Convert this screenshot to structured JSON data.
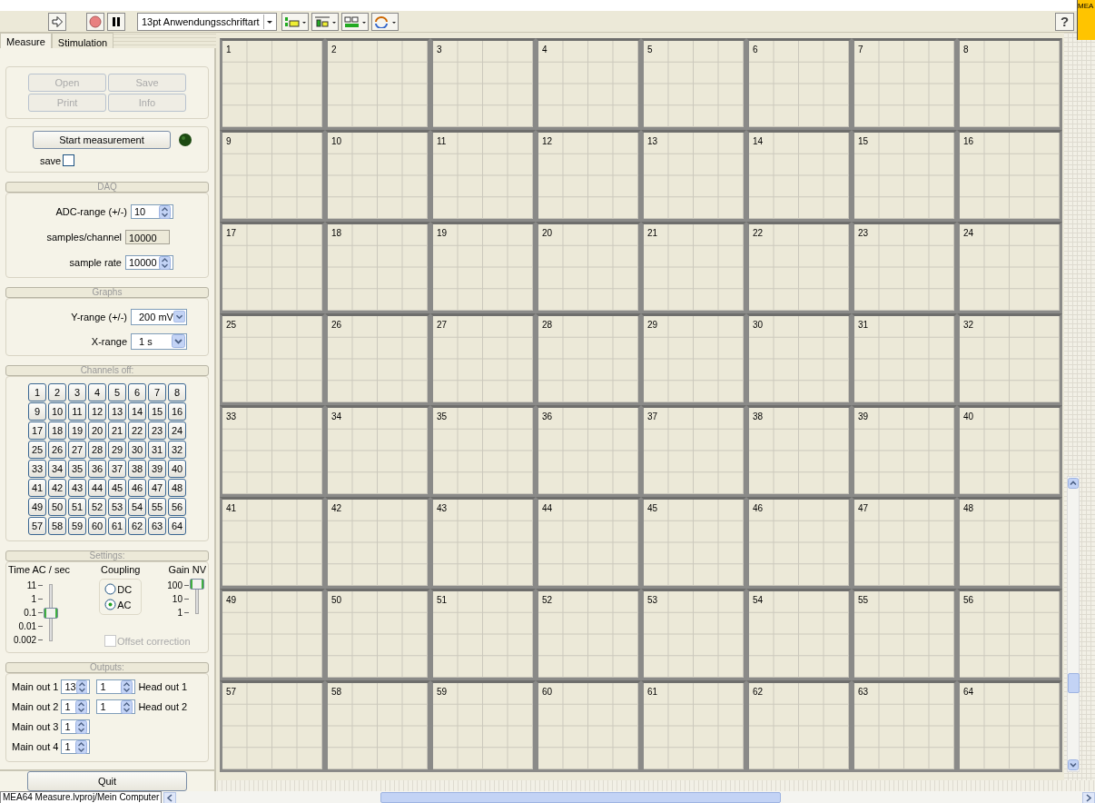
{
  "toolbar": {
    "font_selector": "13pt Anwendungsschriftart",
    "help_label": "?",
    "corner_badge": "MEA"
  },
  "tabs": [
    {
      "label": "Measure",
      "selected": true
    },
    {
      "label": "Stimulation",
      "selected": false
    }
  ],
  "file_buttons": [
    {
      "label": "Open",
      "disabled": true
    },
    {
      "label": "Save",
      "disabled": true
    },
    {
      "label": "Print",
      "disabled": true
    },
    {
      "label": "Info",
      "disabled": true
    }
  ],
  "measurement": {
    "button": "Start measurement",
    "led_on": false,
    "save_label": "save",
    "save_checked": false
  },
  "daq": {
    "title": "DAQ",
    "fields": [
      {
        "label": "ADC-range (+/-)",
        "value": "10",
        "kind": "spinner"
      },
      {
        "label": "samples/channel",
        "value": "10000",
        "kind": "readonly"
      },
      {
        "label": "sample rate",
        "value": "10000",
        "kind": "spinner"
      }
    ]
  },
  "graphs": {
    "title": "Graphs",
    "fields": [
      {
        "label": "Y-range (+/-)",
        "value": "200 mV"
      },
      {
        "label": "X-range",
        "value": "1 s"
      }
    ]
  },
  "channels_off": {
    "title": "Channels off:",
    "buttons": [
      {
        "label": "1",
        "on": false
      },
      {
        "label": "2",
        "on": false
      },
      {
        "label": "3",
        "on": false
      },
      {
        "label": "4",
        "on": false
      },
      {
        "label": "5",
        "on": false
      },
      {
        "label": "6",
        "on": false
      },
      {
        "label": "7",
        "on": false
      },
      {
        "label": "8",
        "on": false
      },
      {
        "label": "9",
        "on": false
      },
      {
        "label": "10",
        "on": false
      },
      {
        "label": "11",
        "on": false
      },
      {
        "label": "12",
        "on": false
      },
      {
        "label": "13",
        "on": false
      },
      {
        "label": "14",
        "on": false
      },
      {
        "label": "15",
        "on": false
      },
      {
        "label": "16",
        "on": false
      },
      {
        "label": "17",
        "on": false
      },
      {
        "label": "18",
        "on": false
      },
      {
        "label": "19",
        "on": false
      },
      {
        "label": "20",
        "on": false
      },
      {
        "label": "21",
        "on": false
      },
      {
        "label": "22",
        "on": false
      },
      {
        "label": "23",
        "on": false
      },
      {
        "label": "24",
        "on": false
      },
      {
        "label": "25",
        "on": false
      },
      {
        "label": "26",
        "on": false
      },
      {
        "label": "27",
        "on": false
      },
      {
        "label": "28",
        "on": false
      },
      {
        "label": "29",
        "on": false
      },
      {
        "label": "30",
        "on": false
      },
      {
        "label": "31",
        "on": false
      },
      {
        "label": "32",
        "on": false
      },
      {
        "label": "33",
        "on": false
      },
      {
        "label": "34",
        "on": false
      },
      {
        "label": "35",
        "on": false
      },
      {
        "label": "36",
        "on": false
      },
      {
        "label": "37",
        "on": false
      },
      {
        "label": "38",
        "on": false
      },
      {
        "label": "39",
        "on": false
      },
      {
        "label": "40",
        "on": false
      },
      {
        "label": "41",
        "on": false
      },
      {
        "label": "42",
        "on": false
      },
      {
        "label": "43",
        "on": false
      },
      {
        "label": "44",
        "on": false
      },
      {
        "label": "45",
        "on": false
      },
      {
        "label": "46",
        "on": false
      },
      {
        "label": "47",
        "on": false
      },
      {
        "label": "48",
        "on": false
      },
      {
        "label": "49",
        "on": false
      },
      {
        "label": "50",
        "on": false
      },
      {
        "label": "51",
        "on": false
      },
      {
        "label": "52",
        "on": false
      },
      {
        "label": "53",
        "on": false
      },
      {
        "label": "54",
        "on": false
      },
      {
        "label": "55",
        "on": false
      },
      {
        "label": "56",
        "on": false
      },
      {
        "label": "57",
        "on": false
      },
      {
        "label": "58",
        "on": false
      },
      {
        "label": "59",
        "on": false
      },
      {
        "label": "60",
        "on": false
      },
      {
        "label": "61",
        "on": false
      },
      {
        "label": "62",
        "on": false
      },
      {
        "label": "63",
        "on": false
      },
      {
        "label": "64",
        "on": false
      }
    ]
  },
  "settings": {
    "title": "Settings:",
    "time_ac": {
      "label": "Time AC / sec",
      "ticks": [
        "11",
        "1",
        "0.1",
        "0.01",
        "0.002"
      ],
      "level": 0.5
    },
    "coupling": {
      "label": "Coupling",
      "options": [
        {
          "label": "DC",
          "selected": false
        },
        {
          "label": "AC",
          "selected": true
        }
      ]
    },
    "gain": {
      "label": "Gain NV",
      "ticks": [
        "100",
        "10",
        "1"
      ],
      "level": 1
    },
    "offset_correction": {
      "label": "Offset correction",
      "checked": false,
      "disabled": true
    }
  },
  "outputs": {
    "title": "Outputs:",
    "rows": [
      {
        "main_label": "Main out 1",
        "main_value": "13",
        "head_value": "1",
        "head_label": "Head out 1"
      },
      {
        "main_label": "Main out 2",
        "main_value": "1",
        "head_value": "1",
        "head_label": "Head out 2"
      },
      {
        "main_label": "Main out 3",
        "main_value": "1"
      },
      {
        "main_label": "Main out 4",
        "main_value": "1"
      }
    ]
  },
  "quit_button": "Quit",
  "channel_graphs": [
    "1",
    "2",
    "3",
    "4",
    "5",
    "6",
    "7",
    "8",
    "9",
    "10",
    "11",
    "12",
    "13",
    "14",
    "15",
    "16",
    "17",
    "18",
    "19",
    "20",
    "21",
    "22",
    "23",
    "24",
    "25",
    "26",
    "27",
    "28",
    "29",
    "30",
    "31",
    "32",
    "33",
    "34",
    "35",
    "36",
    "37",
    "38",
    "39",
    "40",
    "41",
    "42",
    "43",
    "44",
    "45",
    "46",
    "47",
    "48",
    "49",
    "50",
    "51",
    "52",
    "53",
    "54",
    "55",
    "56",
    "57",
    "58",
    "59",
    "60",
    "61",
    "62",
    "63",
    "64"
  ],
  "status_bar": {
    "path": "MEA64 Measure.lvproj/Mein Computer"
  }
}
